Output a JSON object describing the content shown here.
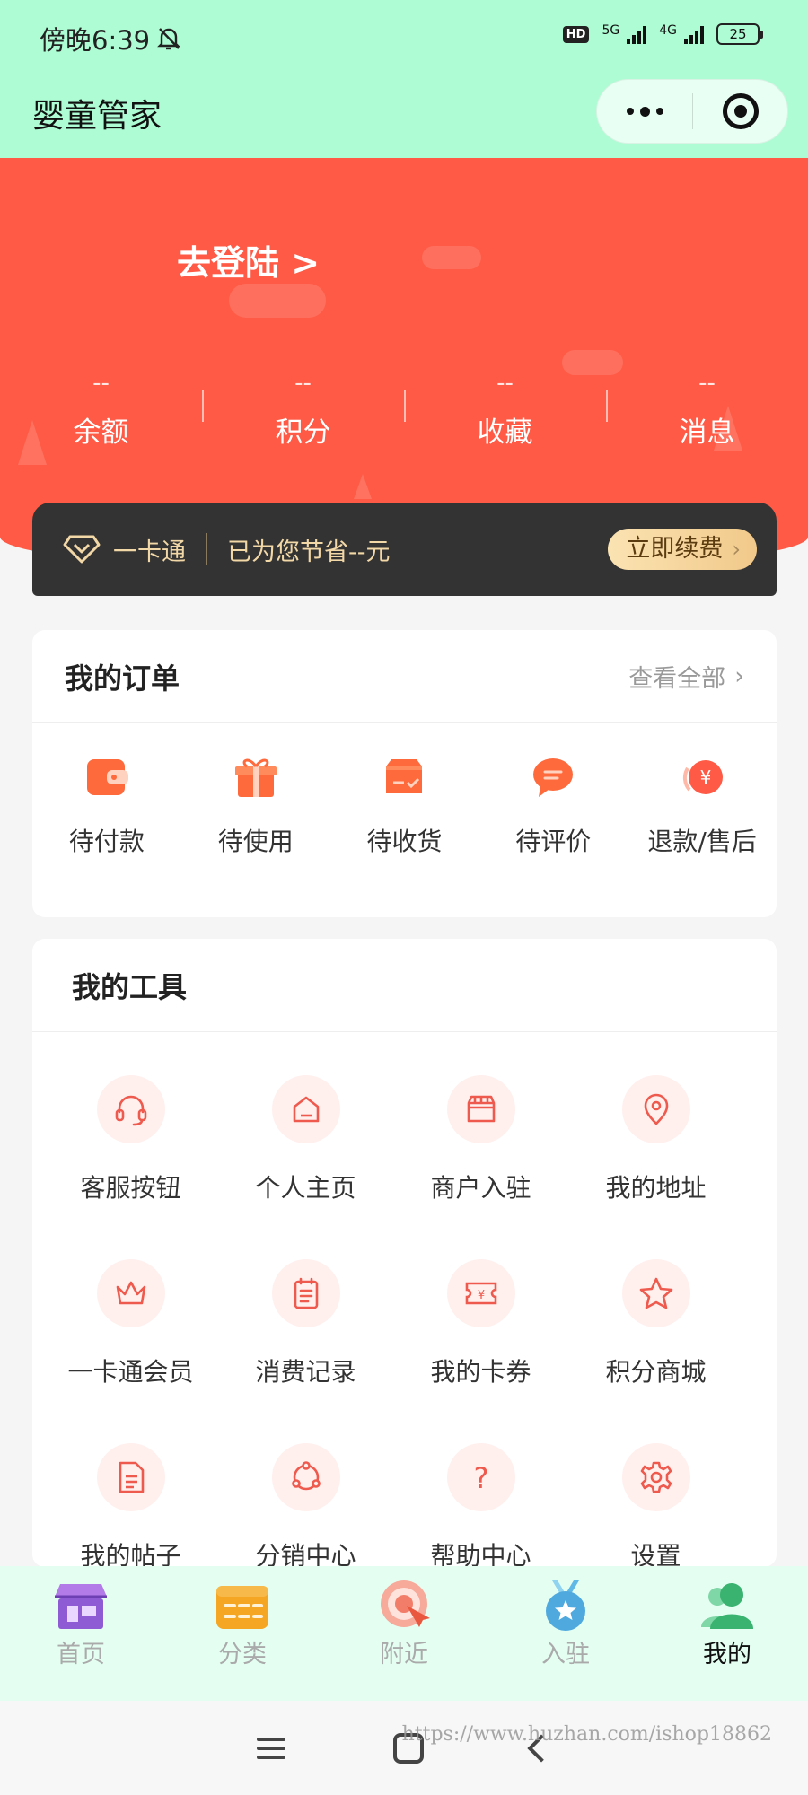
{
  "status_bar": {
    "time": "傍晚6:39",
    "network_badge": "HD",
    "network_5g": "5G",
    "network_4g": "4G",
    "battery": "25"
  },
  "nav": {
    "title": "婴童管家"
  },
  "header": {
    "login_label": "去登陆 >",
    "stats": [
      {
        "value": "--",
        "label": "余额"
      },
      {
        "value": "--",
        "label": "积分"
      },
      {
        "value": "--",
        "label": "收藏"
      },
      {
        "value": "--",
        "label": "消息"
      }
    ]
  },
  "member_card": {
    "name": "一卡通",
    "savings": "已为您节省--元",
    "renew_label": "立即续费"
  },
  "orders": {
    "title": "我的订单",
    "view_all": "查看全部",
    "items": [
      {
        "label": "待付款",
        "icon": "wallet-icon"
      },
      {
        "label": "待使用",
        "icon": "gift-icon"
      },
      {
        "label": "待收货",
        "icon": "delivery-box-icon"
      },
      {
        "label": "待评价",
        "icon": "comment-icon"
      },
      {
        "label": "退款/售后",
        "icon": "refund-icon"
      }
    ]
  },
  "tools": {
    "title": "我的工具",
    "items": [
      {
        "label": "客服按钮",
        "icon": "headset-icon"
      },
      {
        "label": "个人主页",
        "icon": "home-icon"
      },
      {
        "label": "商户入驻",
        "icon": "store-icon"
      },
      {
        "label": "我的地址",
        "icon": "location-pin-icon"
      },
      {
        "label": "一卡通会员",
        "icon": "crown-icon"
      },
      {
        "label": "消费记录",
        "icon": "clipboard-icon"
      },
      {
        "label": "我的卡券",
        "icon": "coupon-icon"
      },
      {
        "label": "积分商城",
        "icon": "star-icon"
      },
      {
        "label": "我的帖子",
        "icon": "document-icon"
      },
      {
        "label": "分销中心",
        "icon": "share-network-icon"
      },
      {
        "label": "帮助中心",
        "icon": "question-icon"
      },
      {
        "label": "设置",
        "icon": "gear-icon"
      }
    ]
  },
  "tabbar": {
    "tabs": [
      {
        "label": "首页",
        "icon": "shop-icon"
      },
      {
        "label": "分类",
        "icon": "category-icon"
      },
      {
        "label": "附近",
        "icon": "nearby-icon"
      },
      {
        "label": "入驻",
        "icon": "medal-icon"
      },
      {
        "label": "我的",
        "icon": "user-icon"
      }
    ],
    "active": "我的"
  },
  "watermark": "https://www.huzhan.com/ishop18862",
  "colors": {
    "header_red": "#ff5a45",
    "nav_green": "#adfcd3",
    "tabbar_bg": "#e4fff2",
    "card_dark": "#333333",
    "gold": "#f3d8a7",
    "icon_red": "#ef5a4e"
  }
}
